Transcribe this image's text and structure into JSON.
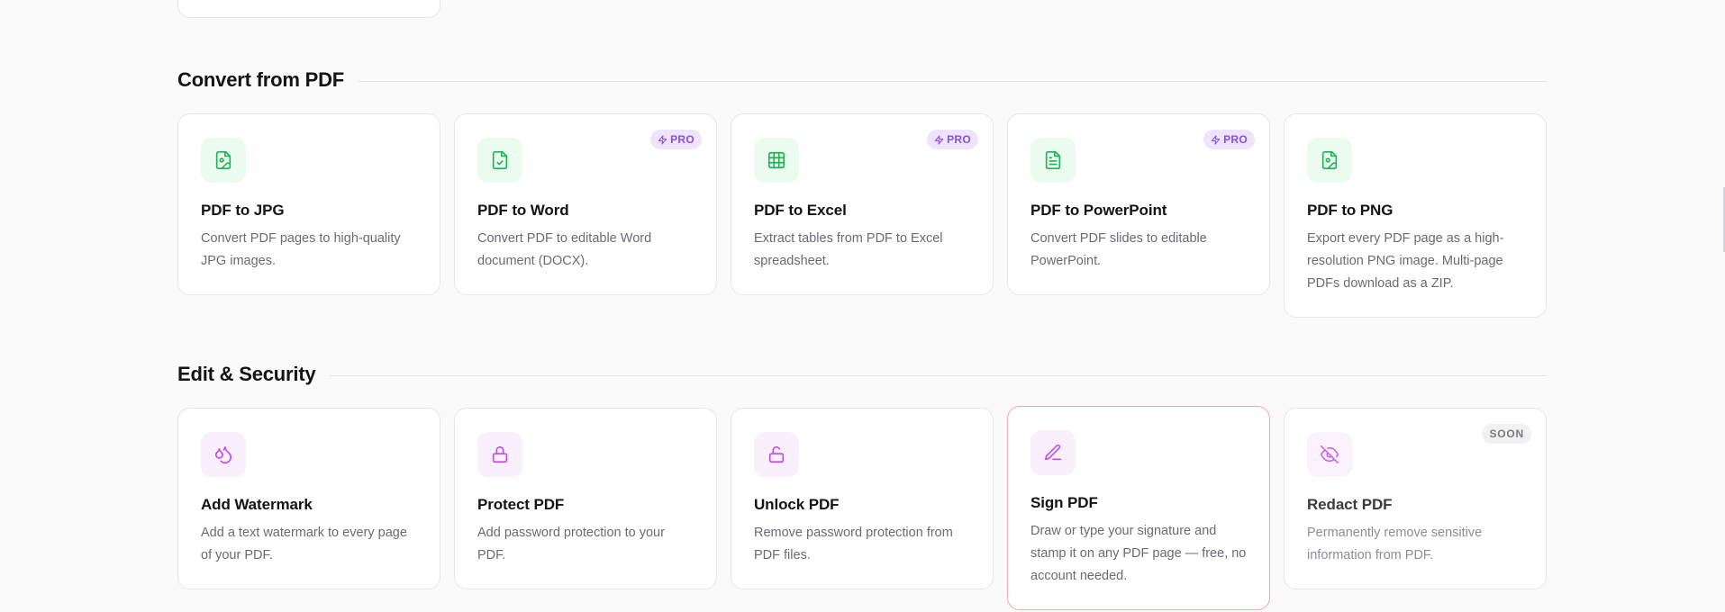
{
  "sections": [
    {
      "title": "Convert from PDF",
      "cards": [
        {
          "title": "PDF to JPG",
          "desc": "Convert PDF pages to high-quality JPG images.",
          "icon": "file-image-icon",
          "badge": ""
        },
        {
          "title": "PDF to Word",
          "desc": "Convert PDF to editable Word document (DOCX).",
          "icon": "file-check-icon",
          "badge": "PRO"
        },
        {
          "title": "PDF to Excel",
          "desc": "Extract tables from PDF to Excel spreadsheet.",
          "icon": "table-icon",
          "badge": "PRO"
        },
        {
          "title": "PDF to PowerPoint",
          "desc": "Convert PDF slides to editable PowerPoint.",
          "icon": "file-text-icon",
          "badge": "PRO"
        },
        {
          "title": "PDF to PNG",
          "desc": "Export every PDF page as a high-resolution PNG image. Multi-page PDFs download as a ZIP.",
          "icon": "file-image-icon",
          "badge": ""
        }
      ]
    },
    {
      "title": "Edit & Security",
      "cards": [
        {
          "title": "Add Watermark",
          "desc": "Add a text watermark to every page of your PDF.",
          "icon": "droplets-icon",
          "badge": ""
        },
        {
          "title": "Protect PDF",
          "desc": "Add password protection to your PDF.",
          "icon": "lock-icon",
          "badge": ""
        },
        {
          "title": "Unlock PDF",
          "desc": "Remove password protection from PDF files.",
          "icon": "lock-open-icon",
          "badge": ""
        },
        {
          "title": "Sign PDF",
          "desc": "Draw or type your signature and stamp it on any PDF page — free, no account needed.",
          "icon": "pen-line-icon",
          "badge": ""
        },
        {
          "title": "Redact PDF",
          "desc": "Permanently remove sensitive information from PDF.",
          "icon": "eye-off-icon",
          "badge": "SOON"
        }
      ]
    }
  ],
  "colors": {
    "convert_icon": "#1fb356",
    "convert_icon_bg": "#ecfbf0",
    "edit_icon": "#c04ee0",
    "edit_icon_bg": "#faf0fd",
    "pro_badge_text": "#8a4fe0",
    "pro_badge_bg": "#eee5fd",
    "soon_badge_text": "#7a7a82",
    "highlight_border": "#f5a6b3"
  }
}
